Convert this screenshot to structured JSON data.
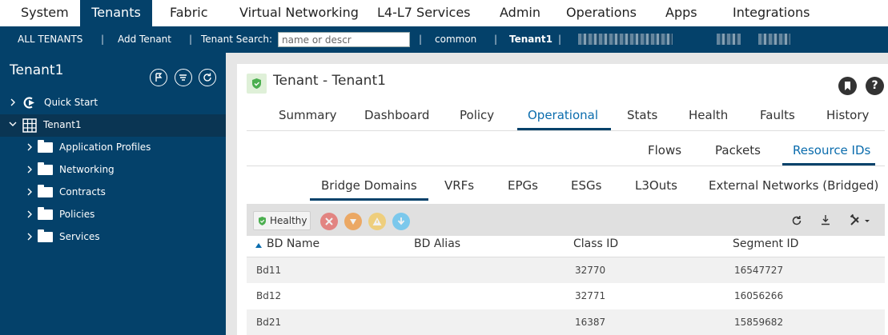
{
  "topnav": [
    {
      "label": "System",
      "active": false
    },
    {
      "label": "Tenants",
      "active": true
    },
    {
      "label": "Fabric",
      "active": false
    },
    {
      "label": "Virtual Networking",
      "active": false
    },
    {
      "label": "L4-L7 Services",
      "active": false
    },
    {
      "label": "Admin",
      "active": false
    },
    {
      "label": "Operations",
      "active": false
    },
    {
      "label": "Apps",
      "active": false
    },
    {
      "label": "Integrations",
      "active": false
    }
  ],
  "subbar": {
    "all_tenants": "ALL TENANTS",
    "add_tenant": "Add Tenant",
    "search_label": "Tenant Search:",
    "search_placeholder": "name or descr",
    "common": "common",
    "current": "Tenant1",
    "separator": "|"
  },
  "sidebar": {
    "title": "Tenant1",
    "items": [
      {
        "label": "Quick Start",
        "icon": "quick-start-icon"
      },
      {
        "label": "Tenant1",
        "icon": "building-icon"
      },
      {
        "label": "Application Profiles",
        "icon": "folder-icon"
      },
      {
        "label": "Networking",
        "icon": "folder-icon"
      },
      {
        "label": "Contracts",
        "icon": "folder-icon"
      },
      {
        "label": "Policies",
        "icon": "folder-icon"
      },
      {
        "label": "Services",
        "icon": "folder-icon"
      }
    ]
  },
  "main": {
    "title": "Tenant - Tenant1",
    "help": "?",
    "tabs": [
      "Summary",
      "Dashboard",
      "Policy",
      "Operational",
      "Stats",
      "Health",
      "Faults",
      "History"
    ],
    "active_tab": "Operational",
    "subtabs": [
      "Flows",
      "Packets",
      "Resource IDs"
    ],
    "active_subtab": "Resource IDs",
    "subtabs2": [
      "Bridge Domains",
      "VRFs",
      "EPGs",
      "ESGs",
      "L3Outs",
      "External Networks (Bridged)"
    ],
    "active_subtab2": "Bridge Domains",
    "health_label": "Healthy",
    "columns": [
      "BD Name",
      "BD Alias",
      "Class ID",
      "Segment ID"
    ],
    "rows": [
      {
        "name": "Bd11",
        "alias": "",
        "class_id": "32770",
        "segment_id": "16547727"
      },
      {
        "name": "Bd12",
        "alias": "",
        "class_id": "32771",
        "segment_id": "16056266"
      },
      {
        "name": "Bd21",
        "alias": "",
        "class_id": "16387",
        "segment_id": "15859682"
      }
    ]
  },
  "colors": {
    "nav_dark": "#04416a",
    "active_blue": "#0a6cad",
    "healthy_green": "#4caf50",
    "critical": "#e53935",
    "major": "#f57c00",
    "minor": "#fbc02d",
    "warning": "#29b6f6"
  }
}
